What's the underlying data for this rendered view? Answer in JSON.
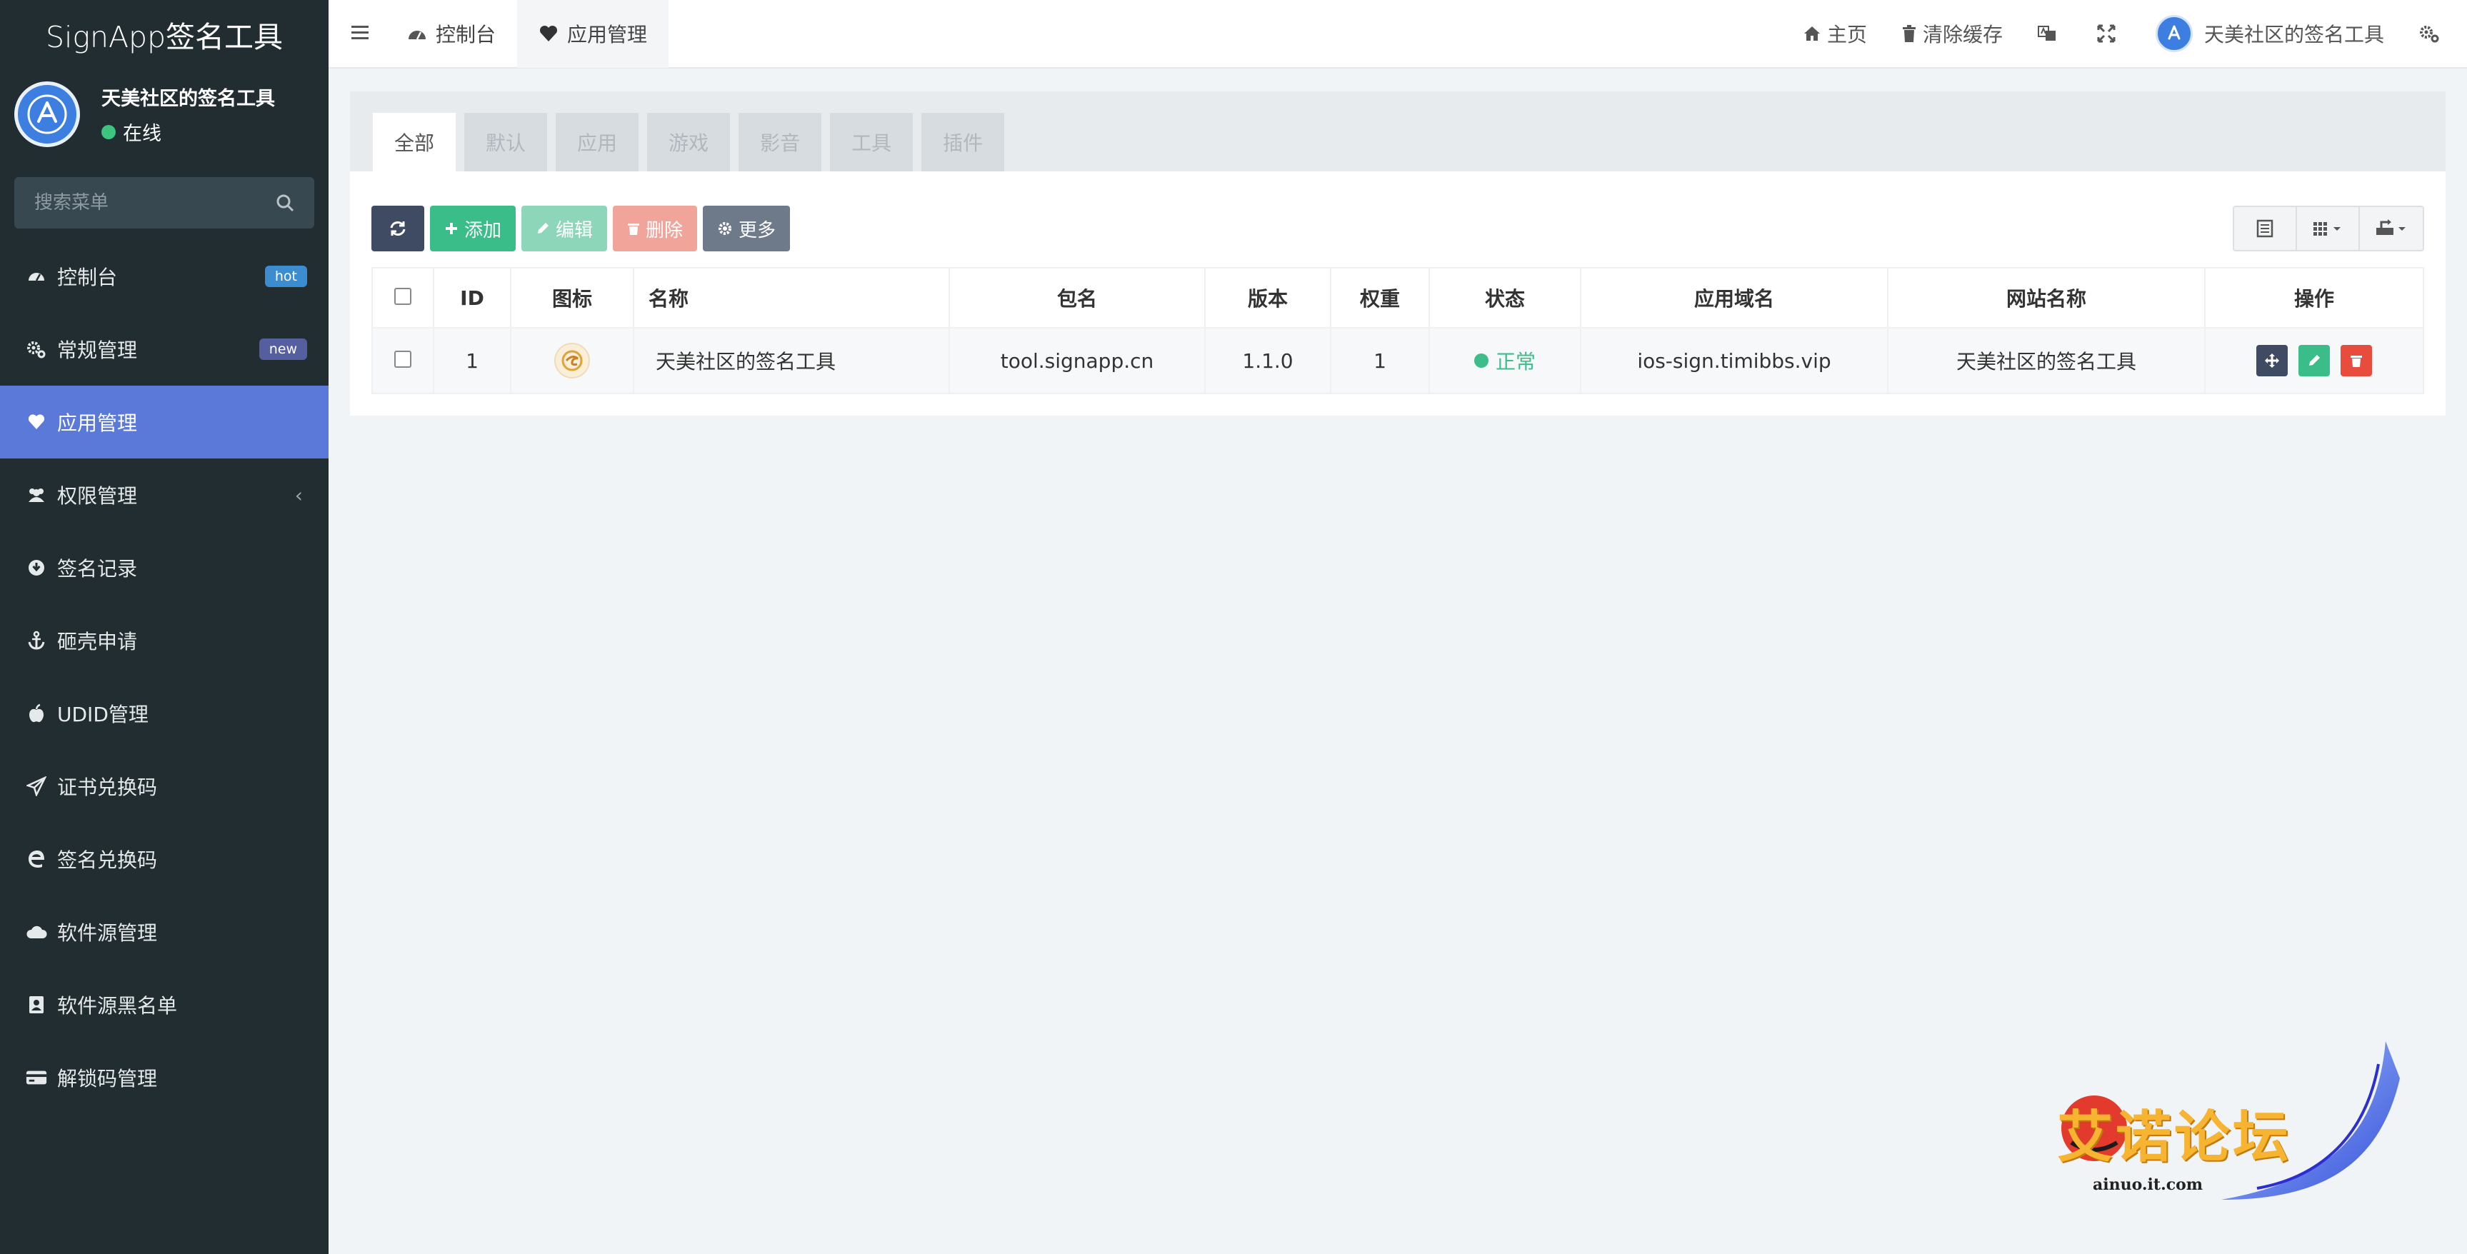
{
  "app": {
    "brand": "SignApp签名工具"
  },
  "user": {
    "name": "天美社区的签名工具",
    "status": "在线"
  },
  "search": {
    "placeholder": "搜索菜单"
  },
  "sidebar": {
    "items": [
      {
        "label": "控制台",
        "icon": "dashboard-icon",
        "badge": "hot"
      },
      {
        "label": "常规管理",
        "icon": "cogs-icon",
        "badge": "new"
      },
      {
        "label": "应用管理",
        "icon": "heart-icon",
        "active": true
      },
      {
        "label": "权限管理",
        "icon": "users-icon",
        "chevron": "‹"
      },
      {
        "label": "签名记录",
        "icon": "download-icon"
      },
      {
        "label": "砸壳申请",
        "icon": "anchor-icon"
      },
      {
        "label": "UDID管理",
        "icon": "apple-icon"
      },
      {
        "label": "证书兑换码",
        "icon": "paper-plane-icon"
      },
      {
        "label": "签名兑换码",
        "icon": "edge-icon"
      },
      {
        "label": "软件源管理",
        "icon": "cloud-icon"
      },
      {
        "label": "软件源黑名单",
        "icon": "address-book-icon"
      },
      {
        "label": "解锁码管理",
        "icon": "credit-card-icon"
      }
    ]
  },
  "header": {
    "tabs": [
      {
        "label": "控制台",
        "icon": "dashboard-icon"
      },
      {
        "label": "应用管理",
        "icon": "heart-icon",
        "active": true
      }
    ],
    "home": "主页",
    "clear_cache": "清除缓存",
    "user_name": "天美社区的签名工具"
  },
  "filter_tabs": [
    "全部",
    "默认",
    "应用",
    "游戏",
    "影音",
    "工具",
    "插件"
  ],
  "toolbar": {
    "add": "添加",
    "edit": "编辑",
    "delete": "删除",
    "more": "更多"
  },
  "table": {
    "columns": [
      "ID",
      "图标",
      "名称",
      "包名",
      "版本",
      "权重",
      "状态",
      "应用域名",
      "网站名称",
      "操作"
    ],
    "rows": [
      {
        "id": "1",
        "name": "天美社区的签名工具",
        "package": "tool.signapp.cn",
        "version": "1.1.0",
        "weight": "1",
        "status": "正常",
        "domain": "ios-sign.timibbs.vip",
        "site_name": "天美社区的签名工具"
      }
    ]
  },
  "watermark": {
    "text": "艾诺论坛",
    "url": "ainuo.it.com"
  },
  "colors": {
    "sidebar_bg": "#222d32",
    "active_menu": "#5b79d8",
    "success": "#3bbd8a",
    "danger": "#e74c3c"
  }
}
